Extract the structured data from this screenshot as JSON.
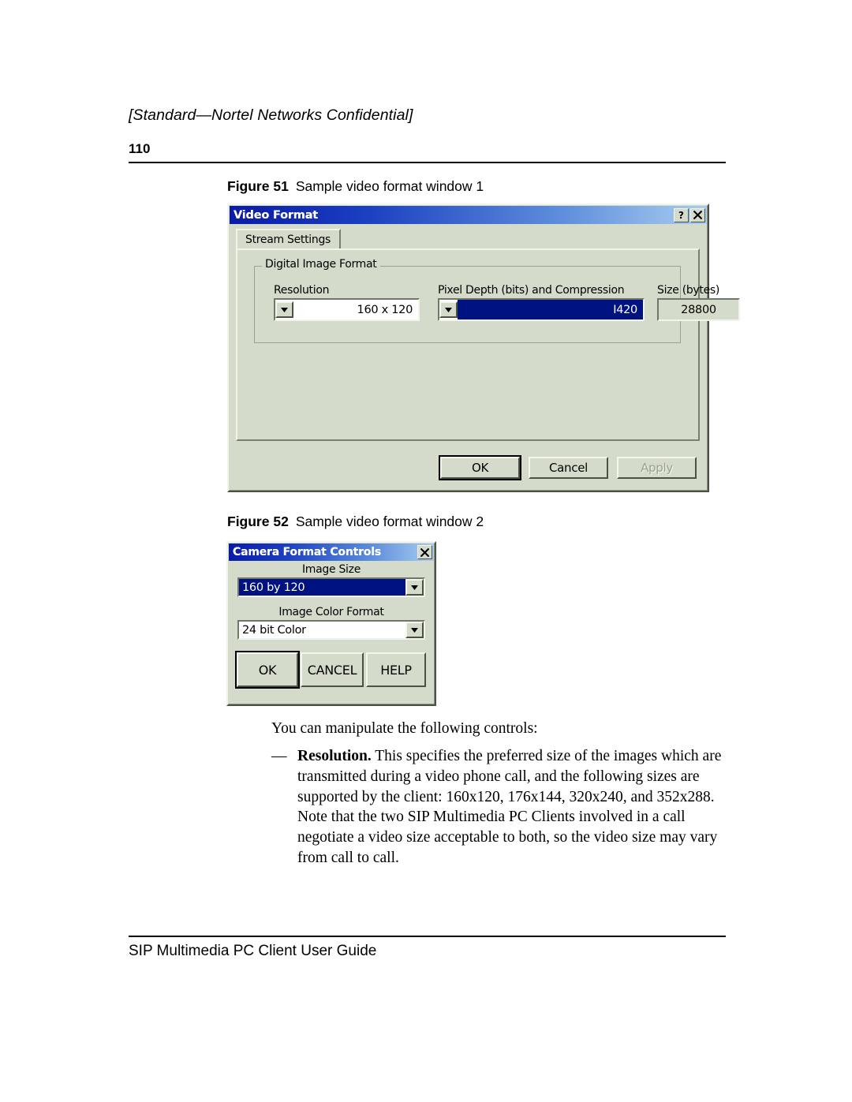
{
  "page": {
    "header_confidential": "[Standard—Nortel Networks Confidential]",
    "page_number": "110",
    "footer_title": "SIP Multimedia PC Client User Guide"
  },
  "figures": {
    "fig51": {
      "number": "Figure 51",
      "caption": "Sample video format window 1"
    },
    "fig52": {
      "number": "Figure 52",
      "caption": "Sample video format window 2"
    }
  },
  "video_format_dialog": {
    "title": "Video Format",
    "help_button": "?",
    "close_button": "✕",
    "tab": "Stream Settings",
    "group_label": "Digital Image Format",
    "resolution": {
      "label": "Resolution",
      "value": "160 x 120"
    },
    "pixel_depth": {
      "label": "Pixel Depth (bits) and Compression",
      "value": "I420"
    },
    "size": {
      "label": "Size (bytes)",
      "value": "28800"
    },
    "buttons": {
      "ok": "OK",
      "cancel": "Cancel",
      "apply": "Apply",
      "apply_state": "disabled"
    }
  },
  "camera_format_dialog": {
    "title": "Camera Format Controls",
    "close_button": "✕",
    "image_size": {
      "label": "Image Size",
      "value": "160 by 120"
    },
    "image_color_format": {
      "label": "Image Color Format",
      "value": "24 bit Color"
    },
    "buttons": {
      "ok": "OK",
      "cancel": "CANCEL",
      "help": "HELP"
    }
  },
  "body": {
    "intro": "You can manipulate the following controls:",
    "bullet_dash": "—",
    "bullet_term": "Resolution.",
    "bullet_text": " This specifies the preferred size of the images which are transmitted during a video phone call, and the following sizes are supported by the client: 160x120, 176x144, 320x240, and 352x288. Note that the two SIP Multimedia PC Clients involved in a call negotiate a video size acceptable to both, so the video size may vary from call to call."
  },
  "colors": {
    "dialog_face": "#d5dbcb",
    "title_gradient_start": "#0a1aa8",
    "title_gradient_end": "#a9cdf0",
    "selection_blue": "#00127f"
  }
}
